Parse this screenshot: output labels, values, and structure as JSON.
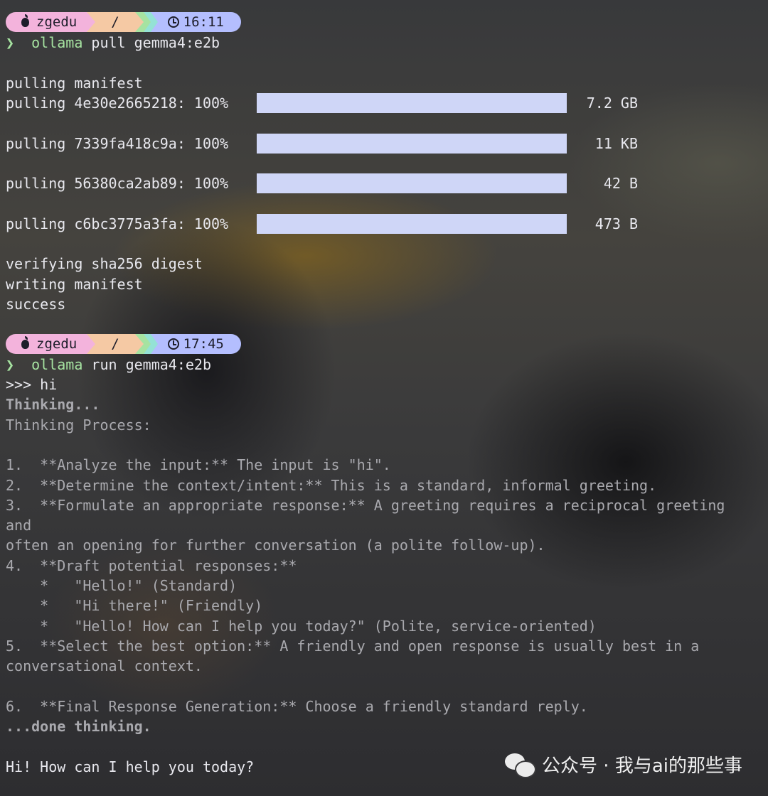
{
  "prompt1": {
    "user": "zgedu",
    "dir": "/",
    "time": "16:11",
    "marker": "❯",
    "command": "ollama",
    "args": " pull gemma4:e2b"
  },
  "pull": {
    "manifest": "pulling manifest",
    "layers": [
      {
        "label": "pulling 4e30e2665218: 100%",
        "progress": 100,
        "size": "7.2 GB"
      },
      {
        "label": "pulling 7339fa418c9a: 100%",
        "progress": 100,
        "size": "11 KB"
      },
      {
        "label": "pulling 56380ca2ab89: 100%",
        "progress": 100,
        "size": "42 B"
      },
      {
        "label": "pulling c6bc3775a3fa: 100%",
        "progress": 100,
        "size": "473 B"
      }
    ],
    "verify": "verifying sha256 digest",
    "writing": "writing manifest",
    "success": "success"
  },
  "prompt2": {
    "user": "zgedu",
    "dir": "/",
    "time": "17:45",
    "marker": "❯",
    "command": "ollama",
    "args": " run gemma4:e2b"
  },
  "chat": {
    "input": ">>> hi",
    "thinking": "Thinking...",
    "process": "Thinking Process:",
    "lines": [
      "1.  **Analyze the input:** The input is \"hi\".",
      "2.  **Determine the context/intent:** This is a standard, informal greeting.",
      "3.  **Formulate an appropriate response:** A greeting requires a reciprocal greeting",
      "and",
      "often an opening for further conversation (a polite follow-up).",
      "4.  **Draft potential responses:**",
      "    *   \"Hello!\" (Standard)",
      "    *   \"Hi there!\" (Friendly)",
      "    *   \"Hello! How can I help you today?\" (Polite, service-oriented)",
      "5.  **Select the best option:** A friendly and open response is usually best in a",
      "conversational context."
    ],
    "line6": "6.  **Final Response Generation:** Choose a friendly standard reply.",
    "done": "...done thinking.",
    "response": "Hi! How can I help you today?"
  },
  "watermark": {
    "text": "公众号 · 我与ai的那些事",
    "icon": "wechat-icon"
  }
}
